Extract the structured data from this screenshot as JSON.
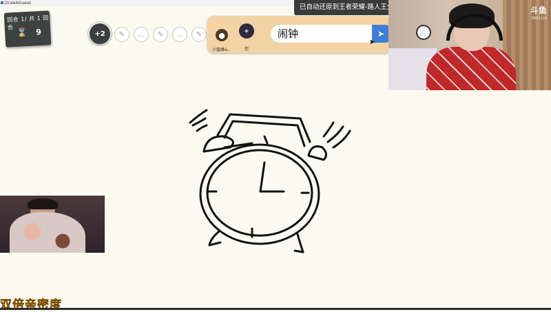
{
  "window": {
    "title": "DrawAGuess"
  },
  "round_card": {
    "round_text": "回合 1/ 共 1 回合",
    "hourglass_icon": "⌛",
    "count": "9"
  },
  "player_bar": {
    "plus_label": "+2",
    "mini_icons": [
      "pencil-icon",
      "chat-icon",
      "pencil-icon",
      "chat-icon",
      "pencil-icon"
    ]
  },
  "answer_panel": {
    "players": [
      {
        "name": "小蜜蜂&..",
        "avatar": "●"
      },
      {
        "name": "您",
        "avatar": "✦"
      }
    ],
    "input_value": "闹钟",
    "send_icon": "➤"
  },
  "toast": {
    "message": "已自动还原到王者荣耀-路人王分区",
    "close": "✕"
  },
  "stream": {
    "logo": "斗鱼",
    "room_id": "0601123"
  },
  "banner": {
    "text": "双倍亲密度"
  }
}
